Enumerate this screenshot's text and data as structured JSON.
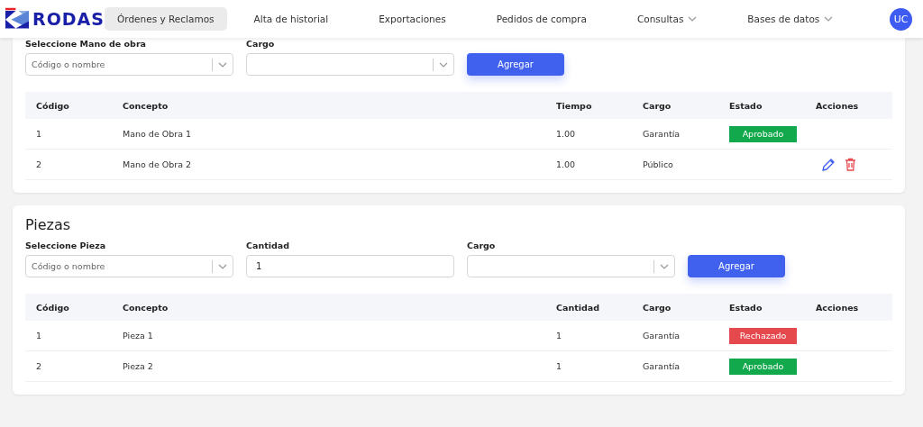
{
  "nav": {
    "logo": "RODAS",
    "items": [
      {
        "label": "Órdenes y Reclamos",
        "selected": true,
        "dropdown": false
      },
      {
        "label": "Alta de historial",
        "selected": false,
        "dropdown": false
      },
      {
        "label": "Exportaciones",
        "selected": false,
        "dropdown": false
      },
      {
        "label": "Pedidos de compra",
        "selected": false,
        "dropdown": false
      },
      {
        "label": "Consultas",
        "selected": false,
        "dropdown": true
      },
      {
        "label": "Bases de datos",
        "selected": false,
        "dropdown": true
      }
    ],
    "avatar": "UC"
  },
  "sections": [
    {
      "fields": [
        {
          "kind": "select",
          "label": "Seleccione Mano de obra",
          "placeholder": "Código o nombre"
        },
        {
          "kind": "select",
          "label": "Cargo"
        }
      ],
      "button": "Agregar",
      "table": {
        "columns": [
          "Código",
          "Concepto",
          "Tiempo",
          "Cargo",
          "Estado",
          "Acciones"
        ],
        "rows": [
          {
            "cells": [
              "1",
              "Mano de Obra 1",
              "1.00",
              "Garantía"
            ],
            "status": {
              "label": "Aprobado",
              "color": "#12a94c"
            },
            "actions": false
          },
          {
            "cells": [
              "2",
              "Mano de Obra 2",
              "1.00",
              "Público"
            ],
            "actions": true
          }
        ]
      }
    },
    {
      "title": "Piezas",
      "fields": [
        {
          "kind": "select",
          "label": "Seleccione Pieza",
          "placeholder": "Código o nombre"
        },
        {
          "kind": "input",
          "label": "Cantidad",
          "value": "1"
        },
        {
          "kind": "select",
          "label": "Cargo"
        }
      ],
      "button": "Agregar",
      "table": {
        "columns": [
          "Código",
          "Concepto",
          "Cantidad",
          "Cargo",
          "Estado",
          "Acciones"
        ],
        "rows": [
          {
            "cells": [
              "1",
              "Pieza 1",
              "1",
              "Garantía"
            ],
            "status": {
              "label": "Rechazado",
              "color": "#e5484d"
            },
            "actions": false
          },
          {
            "cells": [
              "2",
              "Pieza 2",
              "1",
              "Garantía"
            ],
            "status": {
              "label": "Aprobado",
              "color": "#12a94c"
            },
            "actions": false
          }
        ]
      }
    }
  ]
}
